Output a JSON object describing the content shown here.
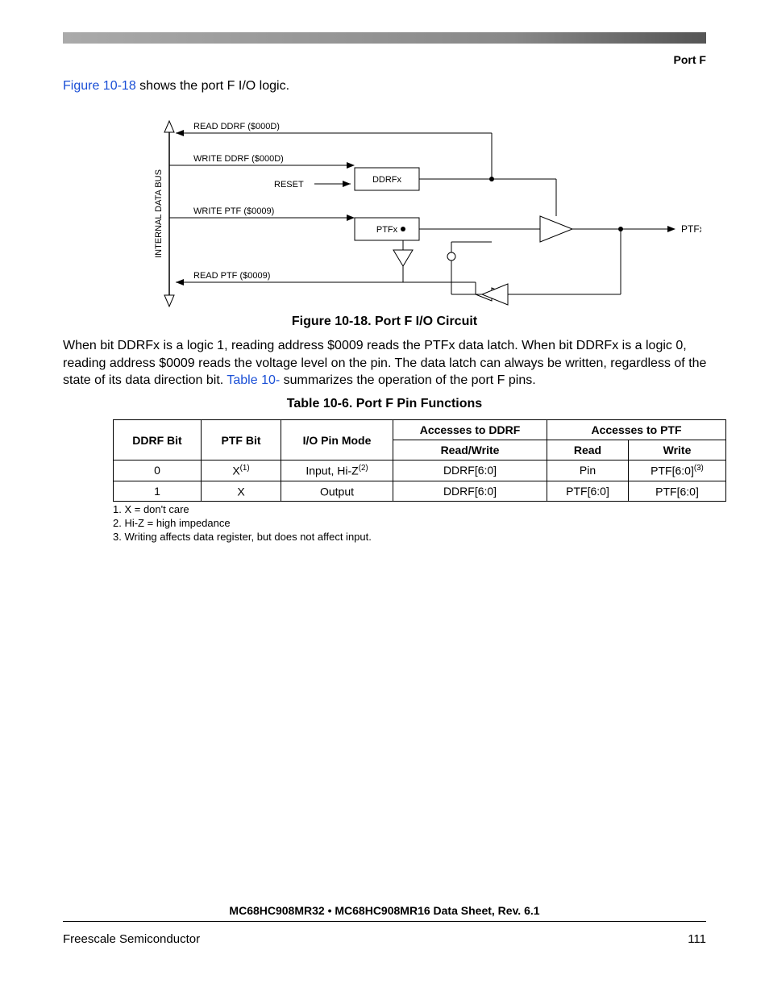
{
  "header": {
    "section": "Port F"
  },
  "intro": {
    "xref": "Figure 10-18",
    "rest": " shows the port F I/O logic."
  },
  "diagram": {
    "bus_label": "INTERNAL DATA BUS",
    "lines": {
      "read_ddrf": "READ DDRF ($000D)",
      "write_ddrf": "WRITE DDRF ($000D)",
      "reset": "RESET",
      "write_ptf": "WRITE PTF ($0009)",
      "read_ptf": "READ PTF ($0009)"
    },
    "boxes": {
      "ddrfx": "DDRFx",
      "ptfx": "PTFx"
    },
    "pin": "PTFx"
  },
  "figure_caption": "Figure 10-18. Port F I/O Circuit",
  "body": {
    "part1": "When bit DDRFx is a logic 1, reading address $0009 reads the PTFx data latch. When bit DDRFx is a logic 0, reading address $0009 reads the voltage level on the pin. The data latch can always be written, regardless of the state of its data direction bit. ",
    "xref": "Table 10-",
    "part2": "   summarizes the operation of the port F pins."
  },
  "table_caption": "Table 10-6. Port F Pin Functions",
  "table": {
    "headers": {
      "ddrf_bit": "DDRF Bit",
      "ptf_bit": "PTF Bit",
      "io_mode": "I/O Pin Mode",
      "acc_ddrf": "Accesses to DDRF",
      "acc_ptf": "Accesses to PTF",
      "rw": "Read/Write",
      "read": "Read",
      "write": "Write"
    },
    "rows": [
      {
        "ddrf": "0",
        "ptf": "X",
        "ptf_sup": "(1)",
        "mode": "Input, Hi-Z",
        "mode_sup": "(2)",
        "rw": "DDRF[6:0]",
        "read": "Pin",
        "write": "PTF[6:0]",
        "write_sup": "(3)"
      },
      {
        "ddrf": "1",
        "ptf": "X",
        "ptf_sup": "",
        "mode": "Output",
        "mode_sup": "",
        "rw": "DDRF[6:0]",
        "read": "PTF[6:0]",
        "write": "PTF[6:0]",
        "write_sup": ""
      }
    ]
  },
  "footnotes": [
    "1. X = don't care",
    "2. Hi-Z = high impedance",
    "3. Writing affects data register, but does not affect input."
  ],
  "footer": {
    "title": "MC68HC908MR32 • MC68HC908MR16 Data Sheet, Rev. 6.1",
    "left": "Freescale Semiconductor",
    "page": "111"
  }
}
